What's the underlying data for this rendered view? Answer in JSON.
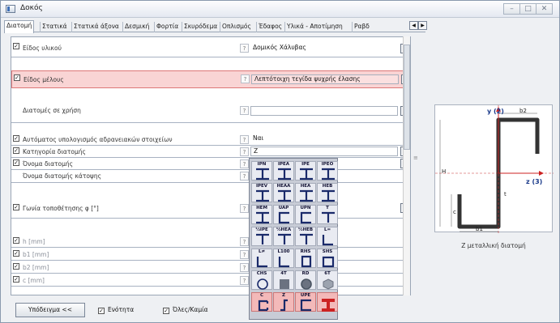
{
  "window": {
    "title": "Δοκός",
    "buttons": [
      "–",
      "□",
      "✕"
    ]
  },
  "tabs": [
    {
      "label": "Διατομή",
      "active": true
    },
    {
      "label": "Στατικά",
      "active": false
    },
    {
      "label": "Στατικά άξονα",
      "active": false
    },
    {
      "label": "Δεσμική",
      "active": false
    },
    {
      "label": "Φορτία",
      "active": false
    },
    {
      "label": "Σκυρόδεμα",
      "active": false
    },
    {
      "label": "Οπλισμός",
      "active": false
    },
    {
      "label": "Έδαφος",
      "active": false
    },
    {
      "label": "Υλικά - Αποτίμηση",
      "active": false
    },
    {
      "label": "Ραβδ",
      "active": false
    }
  ],
  "rows": {
    "material": {
      "label": "Είδος υλικού",
      "value": "Δομικός Χάλυβας",
      "checked": true
    },
    "member_type": {
      "label": "Είδος μέλους",
      "value": "Λεπτότοιχη τεγίδα ψυχρής έλασης",
      "checked": true
    },
    "sections_used": {
      "label": "Διατομές σε χρήση",
      "value": "",
      "checked": false
    },
    "auto_calc": {
      "label": "Αυτόματος υπολογισμός αδρανειακών στοιχείων",
      "value": "Ναι",
      "checked": true
    },
    "category": {
      "label": "Κατηγορία διατομής",
      "value": "Z",
      "checked": true
    },
    "section_name": {
      "label": "Όνομα διατομής",
      "value": "",
      "checked": true
    },
    "section_name_plan": {
      "label": "Όνομα διατομής κάτοψης",
      "value": "",
      "checked": false
    },
    "angle": {
      "label": "Γωνία τοποθέτησης φ [°]",
      "value": "",
      "checked": true
    },
    "h": {
      "label": "h [mm]",
      "value": "",
      "checked": true
    },
    "b1": {
      "label": "b1 [mm]",
      "value": "",
      "checked": true
    },
    "b2": {
      "label": "b2 [mm]",
      "value": "",
      "checked": true
    },
    "c": {
      "label": "c [mm]",
      "value": "",
      "checked": true
    }
  },
  "question_mark": "?",
  "bottom": {
    "example_button": "Υπόδειγμα <<",
    "unit_label": "Ενότητα",
    "all_none_label": "Όλες/Καμία"
  },
  "section_palette": [
    {
      "code": "IPN",
      "shape": "I"
    },
    {
      "code": "IPEA",
      "shape": "I"
    },
    {
      "code": "IPE",
      "shape": "I"
    },
    {
      "code": "IPEO",
      "shape": "I"
    },
    {
      "code": "IPEV",
      "shape": "I"
    },
    {
      "code": "HEAA",
      "shape": "I"
    },
    {
      "code": "HEA",
      "shape": "I"
    },
    {
      "code": "HEB",
      "shape": "I"
    },
    {
      "code": "HEM",
      "shape": "I"
    },
    {
      "code": "UAP",
      "shape": "U"
    },
    {
      "code": "UPN",
      "shape": "U"
    },
    {
      "code": "T",
      "shape": "T"
    },
    {
      "code": "½IPE",
      "shape": "T"
    },
    {
      "code": "½HEA",
      "shape": "T"
    },
    {
      "code": "½HEB",
      "shape": "T"
    },
    {
      "code": "L=",
      "shape": "L"
    },
    {
      "code": "L≠",
      "shape": "L"
    },
    {
      "code": "L100",
      "shape": "L"
    },
    {
      "code": "RHS",
      "shape": "RHS"
    },
    {
      "code": "SHS",
      "shape": "SHS"
    },
    {
      "code": "CHS",
      "shape": "CHS"
    },
    {
      "code": "4T",
      "shape": "SQ"
    },
    {
      "code": "RD",
      "shape": "RD"
    },
    {
      "code": "6T",
      "shape": "HEX"
    },
    {
      "code": "C",
      "shape": "C",
      "highlight": true
    },
    {
      "code": "Z",
      "shape": "Z",
      "highlight": true
    },
    {
      "code": "UPE",
      "shape": "U",
      "highlight": true
    },
    {
      "code": "",
      "shape": "BIGI",
      "highlight": true
    }
  ],
  "preview": {
    "labels": {
      "y": "y (2)",
      "z": "z (3)",
      "b2": "b2",
      "b1": "b1",
      "h": "H",
      "c": "c",
      "t": "t"
    },
    "caption": "Z μεταλλική διατομή"
  },
  "colors": {
    "highlight_row": "#f9d4d4",
    "accent_red": "#cc2222",
    "axis_blue": "#1a3a8a"
  }
}
